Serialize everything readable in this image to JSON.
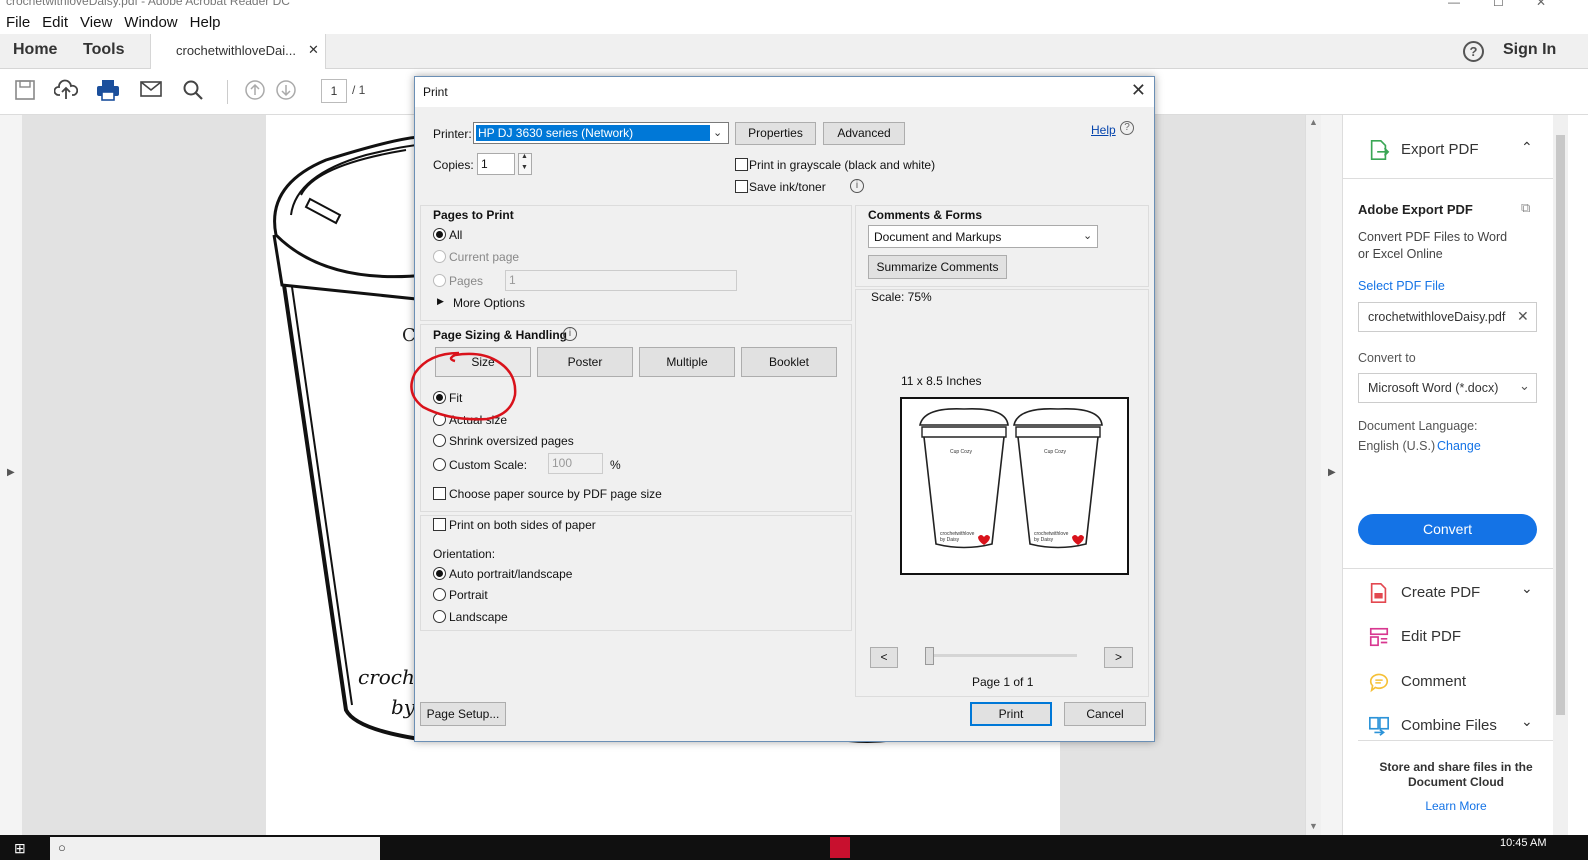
{
  "window": {
    "title": "crochetwithloveDaisy.pdf - Adobe Acrobat Reader DC"
  },
  "menu": [
    "File",
    "Edit",
    "View",
    "Window",
    "Help"
  ],
  "tabs": {
    "home": "Home",
    "tools": "Tools",
    "doc": "crochetwithloveDai...",
    "help": "?",
    "sign_in": "Sign In"
  },
  "toolbar": {
    "page_current": "1",
    "page_total": "/ 1"
  },
  "document": {
    "cup_text_1": "croch",
    "cup_text_2": "by",
    "cup_letter": "C"
  },
  "right_panel": {
    "export_title": "Export PDF",
    "adobe_export": "Adobe Export PDF",
    "desc_1": "Convert PDF Files to Word",
    "desc_2": "or Excel Online",
    "select_file": "Select PDF File",
    "file_name": "crochetwithloveDaisy.pdf",
    "convert_to": "Convert to",
    "format": "Microsoft Word (*.docx)",
    "doc_lang": "Document Language:",
    "lang": "English (U.S.)",
    "change": "Change",
    "convert_btn": "Convert",
    "create_pdf": "Create PDF",
    "edit_pdf": "Edit PDF",
    "comment": "Comment",
    "combine": "Combine Files",
    "store_1": "Store and share files in the",
    "store_2": "Document Cloud",
    "learn_more": "Learn More",
    "colors": {
      "accent": "#1473e6",
      "create": "#e34850",
      "edit": "#d83790",
      "comment": "#f5c037",
      "combine": "#2c93d8",
      "export": "#3aa655"
    }
  },
  "print_dialog": {
    "title": "Print",
    "printer_label": "Printer:",
    "printer_value": "HP DJ 3630 series (Network)",
    "properties": "Properties",
    "advanced": "Advanced",
    "help": "Help",
    "copies_label": "Copies:",
    "copies_value": "1",
    "grayscale": "Print in grayscale (black and white)",
    "save_ink": "Save ink/toner",
    "pages_to_print": "Pages to Print",
    "all": "All",
    "current_page": "Current page",
    "pages": "Pages",
    "pages_value": "1",
    "more_options": "More Options",
    "sizing_title": "Page Sizing & Handling",
    "size_btn": "Size",
    "poster_btn": "Poster",
    "multiple_btn": "Multiple",
    "booklet_btn": "Booklet",
    "fit": "Fit",
    "actual_size": "Actual size",
    "shrink": "Shrink oversized pages",
    "custom_scale": "Custom Scale:",
    "custom_scale_value": "100",
    "percent": "%",
    "paper_source": "Choose paper source by PDF page size",
    "both_sides": "Print on both sides of paper",
    "orientation": "Orientation:",
    "auto": "Auto portrait/landscape",
    "portrait": "Portrait",
    "landscape": "Landscape",
    "comments_forms": "Comments & Forms",
    "cf_value": "Document and Markups",
    "summarize": "Summarize Comments",
    "scale": "Scale:  75%",
    "paper_size": "11 x 8.5 Inches",
    "preview_label_1": "Cup Cozy",
    "preview_label_2": "crochetwithlove by Daisy",
    "prev": "<",
    "next": ">",
    "page_of": "Page 1 of 1",
    "page_setup": "Page Setup...",
    "print_btn": "Print",
    "cancel_btn": "Cancel"
  },
  "taskbar": {
    "time": "10:45 AM"
  }
}
